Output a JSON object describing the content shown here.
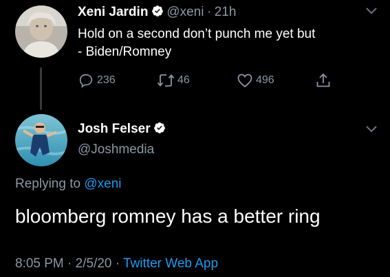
{
  "parent_tweet": {
    "author_name": "Xeni Jardin",
    "handle": "@xeni",
    "separator": "·",
    "time": "21h",
    "text_line1": "Hold on a second don’t punch me yet but",
    "text_line2": "- Biden/Romney",
    "reply_count": "236",
    "retweet_count": "46",
    "like_count": "496"
  },
  "reply_tweet": {
    "author_name": "Josh Felser",
    "handle": "@Joshmedia",
    "replying_prefix": "Replying to",
    "replying_handle": "@xeni",
    "text": "bloomberg romney has a better ring",
    "time": "8:05 PM",
    "separator1": "·",
    "date": "2/5/20",
    "separator2": "·",
    "app": "Twitter Web App"
  },
  "colors": {
    "background": "#000000",
    "accent": "#1d9bf0",
    "muted": "#8b98a5"
  },
  "icons": [
    "verified-badge-icon",
    "chevron-down-icon",
    "reply-icon",
    "retweet-icon",
    "like-icon",
    "share-icon"
  ]
}
